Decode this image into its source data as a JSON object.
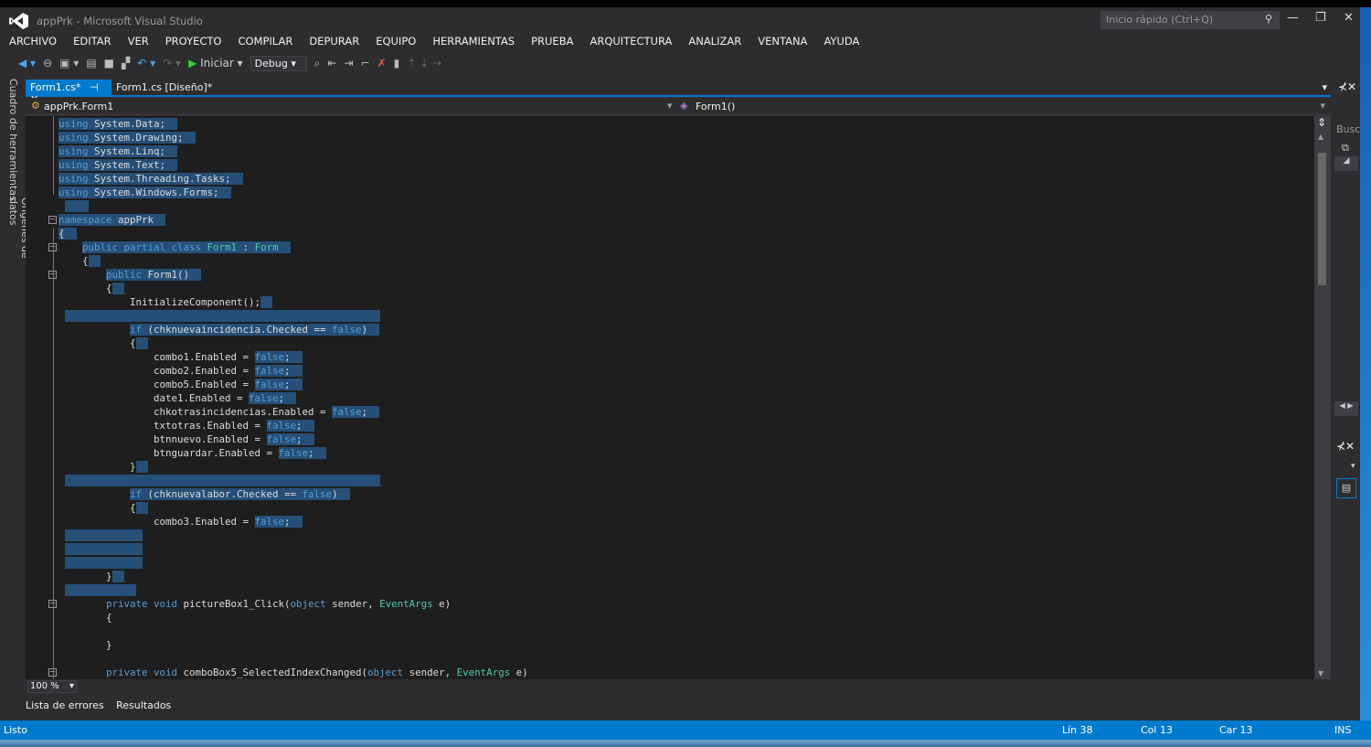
{
  "window": {
    "title": "appPrk - Microsoft Visual Studio",
    "quick_launch_placeholder": "Inicio rápido (Ctrl+Q)"
  },
  "menu": [
    "ARCHIVO",
    "EDITAR",
    "VER",
    "PROYECTO",
    "COMPILAR",
    "DEPURAR",
    "EQUIPO",
    "HERRAMIENTAS",
    "PRUEBA",
    "ARQUITECTURA",
    "ANALIZAR",
    "VENTANA",
    "AYUDA"
  ],
  "toolbar": {
    "start_label": "Iniciar",
    "config": "Debug"
  },
  "left_tabs": [
    "Cuadro de herramientas",
    "Orígenes de datos"
  ],
  "tabs": [
    {
      "label": "Form1.cs*",
      "active": true
    },
    {
      "label": "Form1.cs [Diseño]*",
      "active": false
    }
  ],
  "navbar": {
    "class": "appPrk.Form1",
    "member": "Form1()"
  },
  "right_panel": {
    "search_label": "Busc"
  },
  "editor": {
    "zoom": "100 %",
    "lines": [
      [
        [
          "using",
          "kw"
        ],
        [
          " System.Data;",
          "tx"
        ]
      ],
      [
        [
          "using",
          "kw"
        ],
        [
          " System.Drawing;",
          "tx"
        ]
      ],
      [
        [
          "using",
          "kw"
        ],
        [
          " System.Linq;",
          "tx"
        ]
      ],
      [
        [
          "using",
          "kw"
        ],
        [
          " System.Text;",
          "tx"
        ]
      ],
      [
        [
          "using",
          "kw"
        ],
        [
          " System.Threading.Tasks;",
          "tx"
        ]
      ],
      [
        [
          "using",
          "kw"
        ],
        [
          " System.Windows.Forms;",
          "tx"
        ]
      ],
      [],
      [
        [
          "namespace",
          "kw"
        ],
        [
          " appPrk",
          "tx"
        ]
      ],
      [
        [
          "{",
          "tx"
        ]
      ],
      [
        [
          "    ",
          "tx"
        ],
        [
          "public partial class",
          "kw"
        ],
        [
          " ",
          "tx"
        ],
        [
          "Form1",
          "ty"
        ],
        [
          " : ",
          "tx"
        ],
        [
          "Form",
          "ty"
        ]
      ],
      [
        [
          "    {",
          "tx"
        ]
      ],
      [
        [
          "        ",
          "tx"
        ],
        [
          "public",
          "kw"
        ],
        [
          " Form1()",
          "tx"
        ]
      ],
      [
        [
          "        {",
          "tx"
        ]
      ],
      [
        [
          "            InitializeComponent();",
          "tx"
        ]
      ],
      [],
      [
        [
          "            ",
          "tx"
        ],
        [
          "if",
          "kw"
        ],
        [
          " (chknuevaincidencia.Checked == ",
          "tx"
        ],
        [
          "false",
          "kw"
        ],
        [
          ")",
          "tx"
        ]
      ],
      [
        [
          "            {",
          "tx"
        ]
      ],
      [
        [
          "                combo1.Enabled = ",
          "tx"
        ],
        [
          "false",
          "kw"
        ],
        [
          ";",
          "tx"
        ]
      ],
      [
        [
          "                combo2.Enabled = ",
          "tx"
        ],
        [
          "false",
          "kw"
        ],
        [
          ";",
          "tx"
        ]
      ],
      [
        [
          "                combo5.Enabled = ",
          "tx"
        ],
        [
          "false",
          "kw"
        ],
        [
          ";",
          "tx"
        ]
      ],
      [
        [
          "                date1.Enabled = ",
          "tx"
        ],
        [
          "false",
          "kw"
        ],
        [
          ";",
          "tx"
        ]
      ],
      [
        [
          "                chkotrasincidencias.Enabled = ",
          "tx"
        ],
        [
          "false",
          "kw"
        ],
        [
          ";",
          "tx"
        ]
      ],
      [
        [
          "                txtotras.Enabled = ",
          "tx"
        ],
        [
          "false",
          "kw"
        ],
        [
          ";",
          "tx"
        ]
      ],
      [
        [
          "                btnnuevo.Enabled = ",
          "tx"
        ],
        [
          "false",
          "kw"
        ],
        [
          ";",
          "tx"
        ]
      ],
      [
        [
          "                btnguardar.Enabled = ",
          "tx"
        ],
        [
          "false",
          "kw"
        ],
        [
          ";",
          "tx"
        ]
      ],
      [
        [
          "            }",
          "tx"
        ]
      ],
      [],
      [
        [
          "            ",
          "tx"
        ],
        [
          "if",
          "kw"
        ],
        [
          " (chknuevalabor.Checked == ",
          "tx"
        ],
        [
          "false",
          "kw"
        ],
        [
          ")",
          "tx"
        ]
      ],
      [
        [
          "            {",
          "tx"
        ]
      ],
      [
        [
          "                combo3.Enabled = ",
          "tx"
        ],
        [
          "false",
          "kw"
        ],
        [
          ";",
          "tx"
        ]
      ],
      [],
      [],
      [],
      [
        [
          "        }",
          "tx"
        ]
      ],
      [],
      [
        [
          "        ",
          "tx"
        ],
        [
          "private void",
          "kw"
        ],
        [
          " pictureBox1_Click(",
          "tx"
        ],
        [
          "object",
          "kw"
        ],
        [
          " sender, ",
          "tx"
        ],
        [
          "EventArgs",
          "ty"
        ],
        [
          " e)",
          "tx"
        ]
      ],
      [
        [
          "        {",
          "tx"
        ]
      ],
      [],
      [
        [
          "        }",
          "tx"
        ]
      ],
      [],
      [
        [
          "        ",
          "tx"
        ],
        [
          "private void",
          "kw"
        ],
        [
          " comboBox5_SelectedIndexChanged(",
          "tx"
        ],
        [
          "object",
          "kw"
        ],
        [
          " sender, ",
          "tx"
        ],
        [
          "EventArgs",
          "ty"
        ],
        [
          " e)",
          "tx"
        ]
      ]
    ],
    "selected_line_count": 35
  },
  "bottom_tabs": [
    "Lista de errores",
    "Resultados"
  ],
  "status": {
    "text": "Listo",
    "line": "Lín 38",
    "col": "Col 13",
    "char": "Car 13",
    "mode": "INS"
  },
  "colors": {
    "accent": "#007acc",
    "selection": "#264f78",
    "keyword": "#569cd6",
    "type": "#4ec9b0"
  }
}
